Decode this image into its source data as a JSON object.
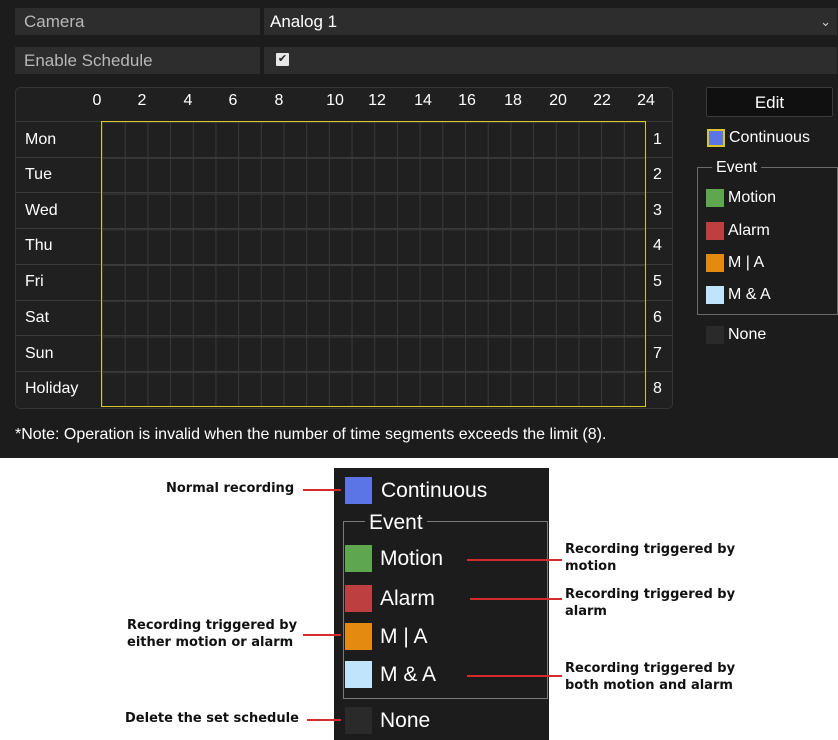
{
  "camera": {
    "label": "Camera",
    "value": "Analog 1"
  },
  "enable_schedule": {
    "label": "Enable Schedule",
    "checked": true,
    "check_glyph": "✔"
  },
  "schedule": {
    "hours": [
      "0",
      "2",
      "4",
      "6",
      "8",
      "10",
      "12",
      "14",
      "16",
      "18",
      "20",
      "22",
      "24"
    ],
    "days": [
      {
        "label": "Mon",
        "num": "1"
      },
      {
        "label": "Tue",
        "num": "2"
      },
      {
        "label": "Wed",
        "num": "3"
      },
      {
        "label": "Thu",
        "num": "4"
      },
      {
        "label": "Fri",
        "num": "5"
      },
      {
        "label": "Sat",
        "num": "6"
      },
      {
        "label": "Sun",
        "num": "7"
      },
      {
        "label": "Holiday",
        "num": "8"
      }
    ],
    "grid_border_color": "#d8c728"
  },
  "edit_button": "Edit",
  "legend": {
    "continuous": {
      "label": "Continuous",
      "color": "#5b74e6"
    },
    "event_title": "Event",
    "motion": {
      "label": "Motion",
      "color": "#5fa74f"
    },
    "alarm": {
      "label": "Alarm",
      "color": "#bd3f3f"
    },
    "m_or_a": {
      "label": "M | A",
      "color": "#e58a10"
    },
    "m_and_a": {
      "label": "M & A",
      "color": "#bfe4fb"
    },
    "none": {
      "label": "None",
      "color": "#2a2a2a"
    }
  },
  "note": "*Note: Operation is invalid when the number of time segments exceeds the limit (8).",
  "annotations": {
    "normal": "Normal recording",
    "motion": [
      "Recording triggered by",
      "motion"
    ],
    "alarm": [
      "Recording triggered by",
      "alarm"
    ],
    "either": [
      "Recording triggered by",
      "either motion or alarm"
    ],
    "both": [
      "Recording triggered by",
      "both motion and alarm"
    ],
    "delete": "Delete the set schedule"
  }
}
